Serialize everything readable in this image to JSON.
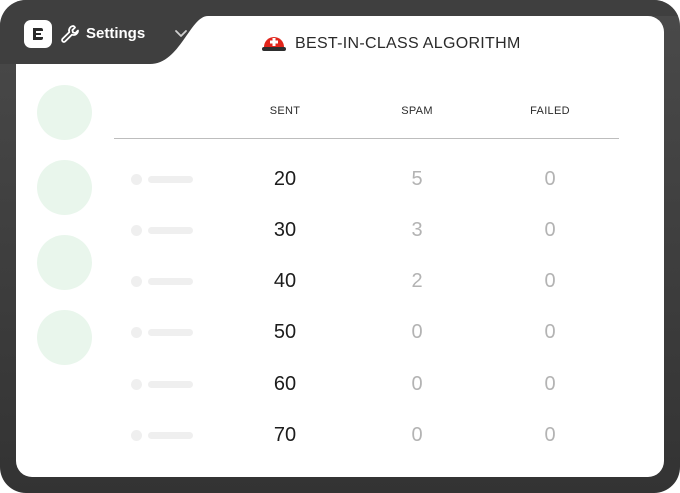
{
  "header": {
    "settings_label": "Settings",
    "title": "BEST-IN-CLASS ALGORITHM"
  },
  "icons": {
    "logo": "logo-e-icon",
    "wrench": "wrench-icon",
    "chevron": "chevron-down-icon",
    "helmet": "red-helmet-icon"
  },
  "colors": {
    "frame": "#3d3d3d",
    "avatar_placeholder": "#e9f6ec",
    "helmet": "#e1251b"
  },
  "table": {
    "columns": [
      "SENT",
      "SPAM",
      "FAILED"
    ],
    "rows": [
      {
        "sent": "20",
        "spam": "5",
        "failed": "0"
      },
      {
        "sent": "30",
        "spam": "3",
        "failed": "0"
      },
      {
        "sent": "40",
        "spam": "2",
        "failed": "0"
      },
      {
        "sent": "50",
        "spam": "0",
        "failed": "0"
      },
      {
        "sent": "60",
        "spam": "0",
        "failed": "0"
      },
      {
        "sent": "70",
        "spam": "0",
        "failed": "0"
      }
    ]
  }
}
